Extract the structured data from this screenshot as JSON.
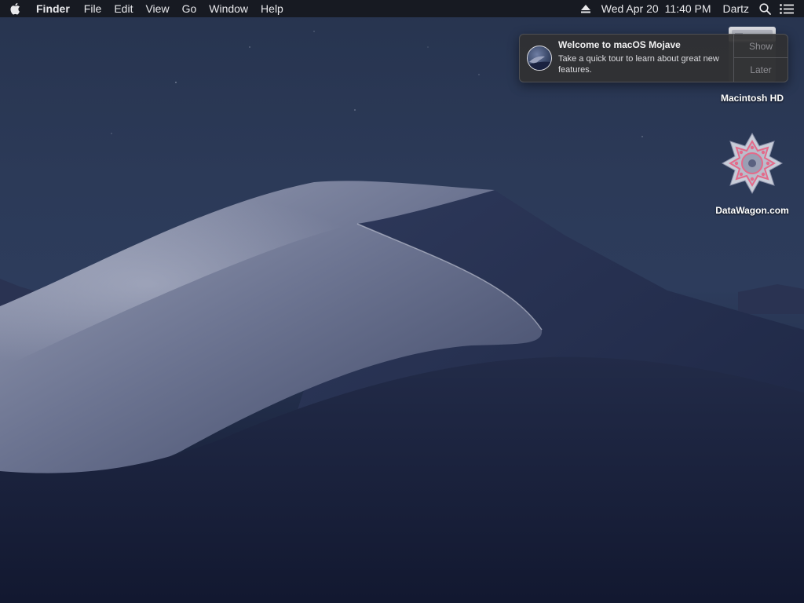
{
  "menubar": {
    "apple_icon": "apple-logo-icon",
    "app_name": "Finder",
    "menus": [
      "File",
      "Edit",
      "View",
      "Go",
      "Window",
      "Help"
    ],
    "status": {
      "eject_icon": "eject-icon",
      "date": "Wed Apr 20",
      "time": "11:40 PM",
      "user": "Dartz",
      "spotlight_icon": "spotlight-search-icon",
      "notification_center_icon": "notification-center-icon"
    }
  },
  "notification": {
    "icon": "macos-mojave-icon",
    "title": "Welcome to macOS Mojave",
    "body": "Take a quick tour to learn about great new features.",
    "actions": [
      "Show",
      "Later"
    ]
  },
  "desktop": {
    "icons": [
      {
        "label": "Macintosh HD",
        "icon": "hard-drive-icon"
      },
      {
        "label": "DataWagon.com",
        "icon": "datawagon-logo-icon"
      }
    ]
  },
  "colors": {
    "menubar": "#16181e",
    "sky": "#2c3a58",
    "dune": "#8a90a8",
    "notification_bg": "#303032"
  }
}
